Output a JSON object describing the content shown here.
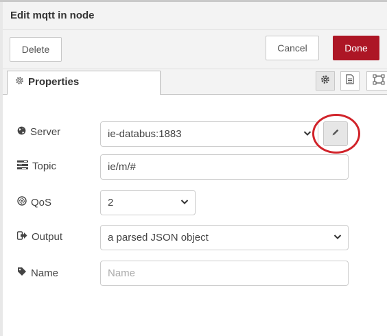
{
  "header": {
    "title": "Edit mqtt in node"
  },
  "toolbar": {
    "delete_label": "Delete",
    "cancel_label": "Cancel",
    "done_label": "Done"
  },
  "tabs": {
    "properties_label": "Properties"
  },
  "tab_icons": [
    "gear-icon",
    "document-icon",
    "frame-icon"
  ],
  "form": {
    "server": {
      "label": "Server",
      "value": "ie-databus:1883",
      "icon": "globe-icon"
    },
    "topic": {
      "label": "Topic",
      "value": "ie/m/#",
      "icon": "tasks-icon"
    },
    "qos": {
      "label": "QoS",
      "value": "2",
      "icon": "qos-icon"
    },
    "output": {
      "label": "Output",
      "value": "a parsed JSON object",
      "icon": "sign-out-icon"
    },
    "name": {
      "label": "Name",
      "value": "",
      "placeholder": "Name",
      "icon": "tag-icon"
    }
  },
  "colors": {
    "done": "#ad1625",
    "annotation": "#d1232a"
  }
}
